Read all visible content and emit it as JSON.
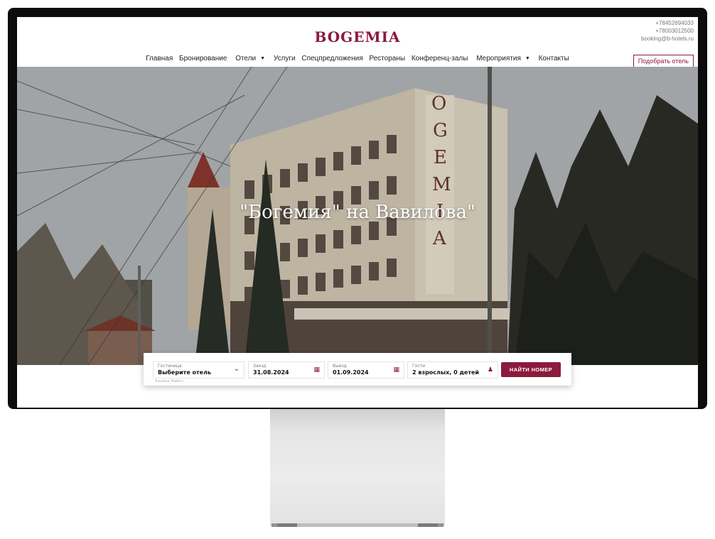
{
  "header": {
    "logo": "BOGEMIA",
    "nav": [
      "Главная",
      "Бронирование",
      "Отели",
      "Услуги",
      "Спецпредложения",
      "Рестораны",
      "Конференц-залы",
      "Мероприятия",
      "Контакты"
    ],
    "phone1": "+78452694033",
    "phone2": "+78003012500",
    "email": "booking@b-hotels.ru",
    "pick_button": "Подобрать отель"
  },
  "hero": {
    "title": "\"Богемия\" на Вавилова\"",
    "slide_count": 5,
    "active_slide": 1
  },
  "booking": {
    "hotel_label": "Гостиница",
    "hotel_value": "Выберите отель",
    "checkin_label": "Заезд",
    "checkin_value": "31.08.2024",
    "checkout_label": "Выезд",
    "checkout_value": "01.09.2024",
    "guests_label": "Гости",
    "guests_value": "2 взрослых, 0 детей",
    "find_button": "НАЙТИ НОМЕР",
    "powered": "TravelLine: Platform"
  },
  "colors": {
    "brand": "#8b1a3d"
  },
  "icons": {
    "hotel_select": "chevron-down-icon",
    "dates": "calendar-icon",
    "guests": "person-icon"
  }
}
